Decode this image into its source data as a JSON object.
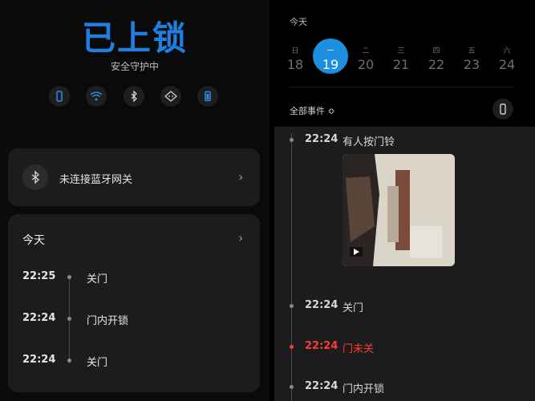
{
  "lock": {
    "title": "已上锁",
    "subtitle": "安全守护中"
  },
  "status_icons": [
    "phone-icon",
    "wifi-icon",
    "bluetooth-icon",
    "face-icon",
    "battery-icon"
  ],
  "gateway_card": {
    "label": "未连接蓝牙网关"
  },
  "today_card": {
    "title": "今天",
    "events": [
      {
        "time": "22:25",
        "label": "关门"
      },
      {
        "time": "22:24",
        "label": "门内开锁"
      },
      {
        "time": "22:24",
        "label": "关门"
      }
    ]
  },
  "calendar": {
    "label": "今天",
    "days": [
      {
        "weekday": "日",
        "date": "18"
      },
      {
        "weekday": "一",
        "date": "19",
        "selected": true
      },
      {
        "weekday": "二",
        "date": "20"
      },
      {
        "weekday": "三",
        "date": "21"
      },
      {
        "weekday": "四",
        "date": "22"
      },
      {
        "weekday": "五",
        "date": "23"
      },
      {
        "weekday": "六",
        "date": "24"
      }
    ]
  },
  "filter": {
    "label": "全部事件 ≎"
  },
  "timeline": [
    {
      "time": "22:24",
      "label": "有人按门铃",
      "has_video": true
    },
    {
      "time": "22:24",
      "label": "关门"
    },
    {
      "time": "22:24",
      "label": "门未关",
      "alert": true
    },
    {
      "time": "22:24",
      "label": "门内开锁"
    }
  ],
  "colors": {
    "accent": "#1d8fe1",
    "alert": "#ff3b30",
    "card": "#1c1c1e"
  }
}
